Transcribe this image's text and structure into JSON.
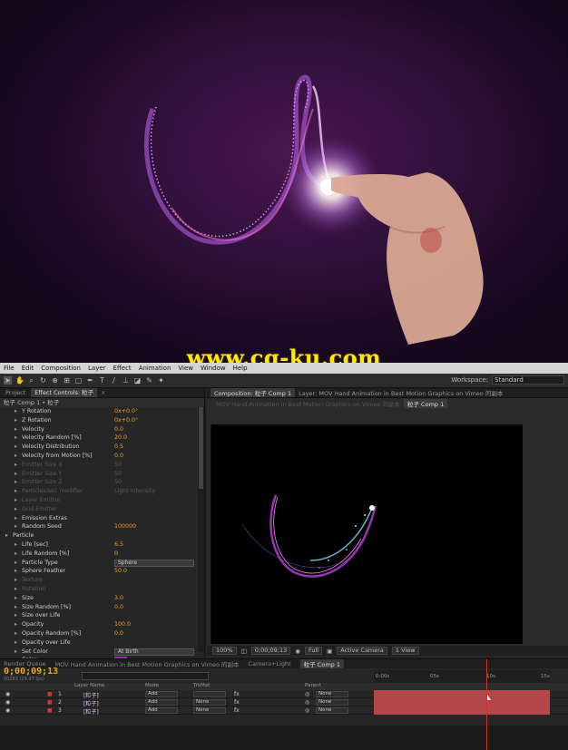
{
  "watermark": "www.cg-ku.com",
  "menu": [
    "File",
    "Edit",
    "Composition",
    "Layer",
    "Effect",
    "Animation",
    "View",
    "Window",
    "Help"
  ],
  "workspace": {
    "label": "Workspace:",
    "value": "Standard"
  },
  "left_tabs": {
    "project": "Project",
    "effect_controls": "Effect Controls: 粒子"
  },
  "effect_header": "粒子 Comp 1 • 粒子",
  "effect_rows": [
    {
      "name": "Y Rotation",
      "value": "0x+0.0°",
      "indent": 1,
      "dim": false
    },
    {
      "name": "Z Rotation",
      "value": "0x+0.0°",
      "indent": 1,
      "dim": false
    },
    {
      "name": "Velocity",
      "value": "0.0",
      "indent": 1,
      "dim": false
    },
    {
      "name": "Velocity Random [%]",
      "value": "20.0",
      "indent": 1,
      "dim": false
    },
    {
      "name": "Velocity Distribution",
      "value": "0.5",
      "indent": 1,
      "dim": false
    },
    {
      "name": "Velocity from Motion [%]",
      "value": "0.0",
      "indent": 1,
      "dim": false
    },
    {
      "name": "Emitter Size X",
      "value": "50",
      "indent": 1,
      "dim": true
    },
    {
      "name": "Emitter Size Y",
      "value": "50",
      "indent": 1,
      "dim": true
    },
    {
      "name": "Emitter Size Z",
      "value": "50",
      "indent": 1,
      "dim": true
    },
    {
      "name": "Particles/sec modifier",
      "value": "Light Intensity",
      "indent": 1,
      "dim": true
    },
    {
      "name": "Layer Emitter",
      "value": "",
      "indent": 1,
      "dim": true
    },
    {
      "name": "Grid Emitter",
      "value": "",
      "indent": 1,
      "dim": true
    },
    {
      "name": "Emission Extras",
      "value": "",
      "indent": 1,
      "dim": false
    },
    {
      "name": "Random Seed",
      "value": "100000",
      "indent": 1,
      "dim": false
    },
    {
      "name": "Particle",
      "value": "",
      "indent": 0,
      "dim": false
    },
    {
      "name": "Life [sec]",
      "value": "6.5",
      "indent": 1,
      "dim": false
    },
    {
      "name": "Life Random [%]",
      "value": "0",
      "indent": 1,
      "dim": false
    },
    {
      "name": "Particle Type",
      "value": "Sphere",
      "indent": 1,
      "dim": false,
      "select": true
    },
    {
      "name": "Sphere Feather",
      "value": "50.0",
      "indent": 1,
      "dim": false
    },
    {
      "name": "Texture",
      "value": "",
      "indent": 1,
      "dim": true
    },
    {
      "name": "Rotation",
      "value": "",
      "indent": 1,
      "dim": true
    },
    {
      "name": "Size",
      "value": "3.0",
      "indent": 1,
      "dim": false
    },
    {
      "name": "Size Random [%]",
      "value": "0.0",
      "indent": 1,
      "dim": false
    },
    {
      "name": "Size over Life",
      "value": "",
      "indent": 1,
      "dim": false
    },
    {
      "name": "Opacity",
      "value": "100.0",
      "indent": 1,
      "dim": false
    },
    {
      "name": "Opacity Random [%]",
      "value": "0.0",
      "indent": 1,
      "dim": false
    },
    {
      "name": "Opacity over Life",
      "value": "",
      "indent": 1,
      "dim": false
    },
    {
      "name": "Set Color",
      "value": "At Birth",
      "indent": 1,
      "dim": false,
      "select": true
    },
    {
      "name": "Color",
      "value": "",
      "indent": 1,
      "dim": false,
      "swatch": true
    }
  ],
  "comp_tabs": {
    "composition": "Composition: 粒子 Comp 1",
    "layer": "Layer: MOV Hand Animation in Best Motion Graphics on Vimeo 的副本"
  },
  "comp_subtabs": [
    "MOV Hand Animation in Best Motion Graphics on Vimeo 的副本",
    "粒子 Comp 1"
  ],
  "comp_bottom": {
    "zoom": "100%",
    "time": "0;00;09;13",
    "resolution": "Full",
    "camera": "Active Camera",
    "view": "1 View"
  },
  "timeline_tabs": [
    "Render Queue",
    "MOV Hand Animation in Best Motion Graphics on Vimeo 的副本",
    "Camera+Light",
    "粒子 Comp 1"
  ],
  "timecode": "0;00;09;13",
  "fps": "00283 (29.97 fps)",
  "col_headers": {
    "layer_name": "Layer Name",
    "mode": "Mode",
    "trkmat": "TrkMat",
    "parent": "Parent"
  },
  "ruler": [
    "0:00s",
    "05s",
    "10s",
    "15s"
  ],
  "layers": [
    {
      "num": "1",
      "name": "[粒子]",
      "mode": "Add",
      "trkmat": "",
      "parent": "None"
    },
    {
      "num": "2",
      "name": "[粒子]",
      "mode": "Add",
      "trkmat": "None",
      "parent": "None"
    },
    {
      "num": "3",
      "name": "[粒子]",
      "mode": "Add",
      "trkmat": "None",
      "parent": "None"
    }
  ]
}
